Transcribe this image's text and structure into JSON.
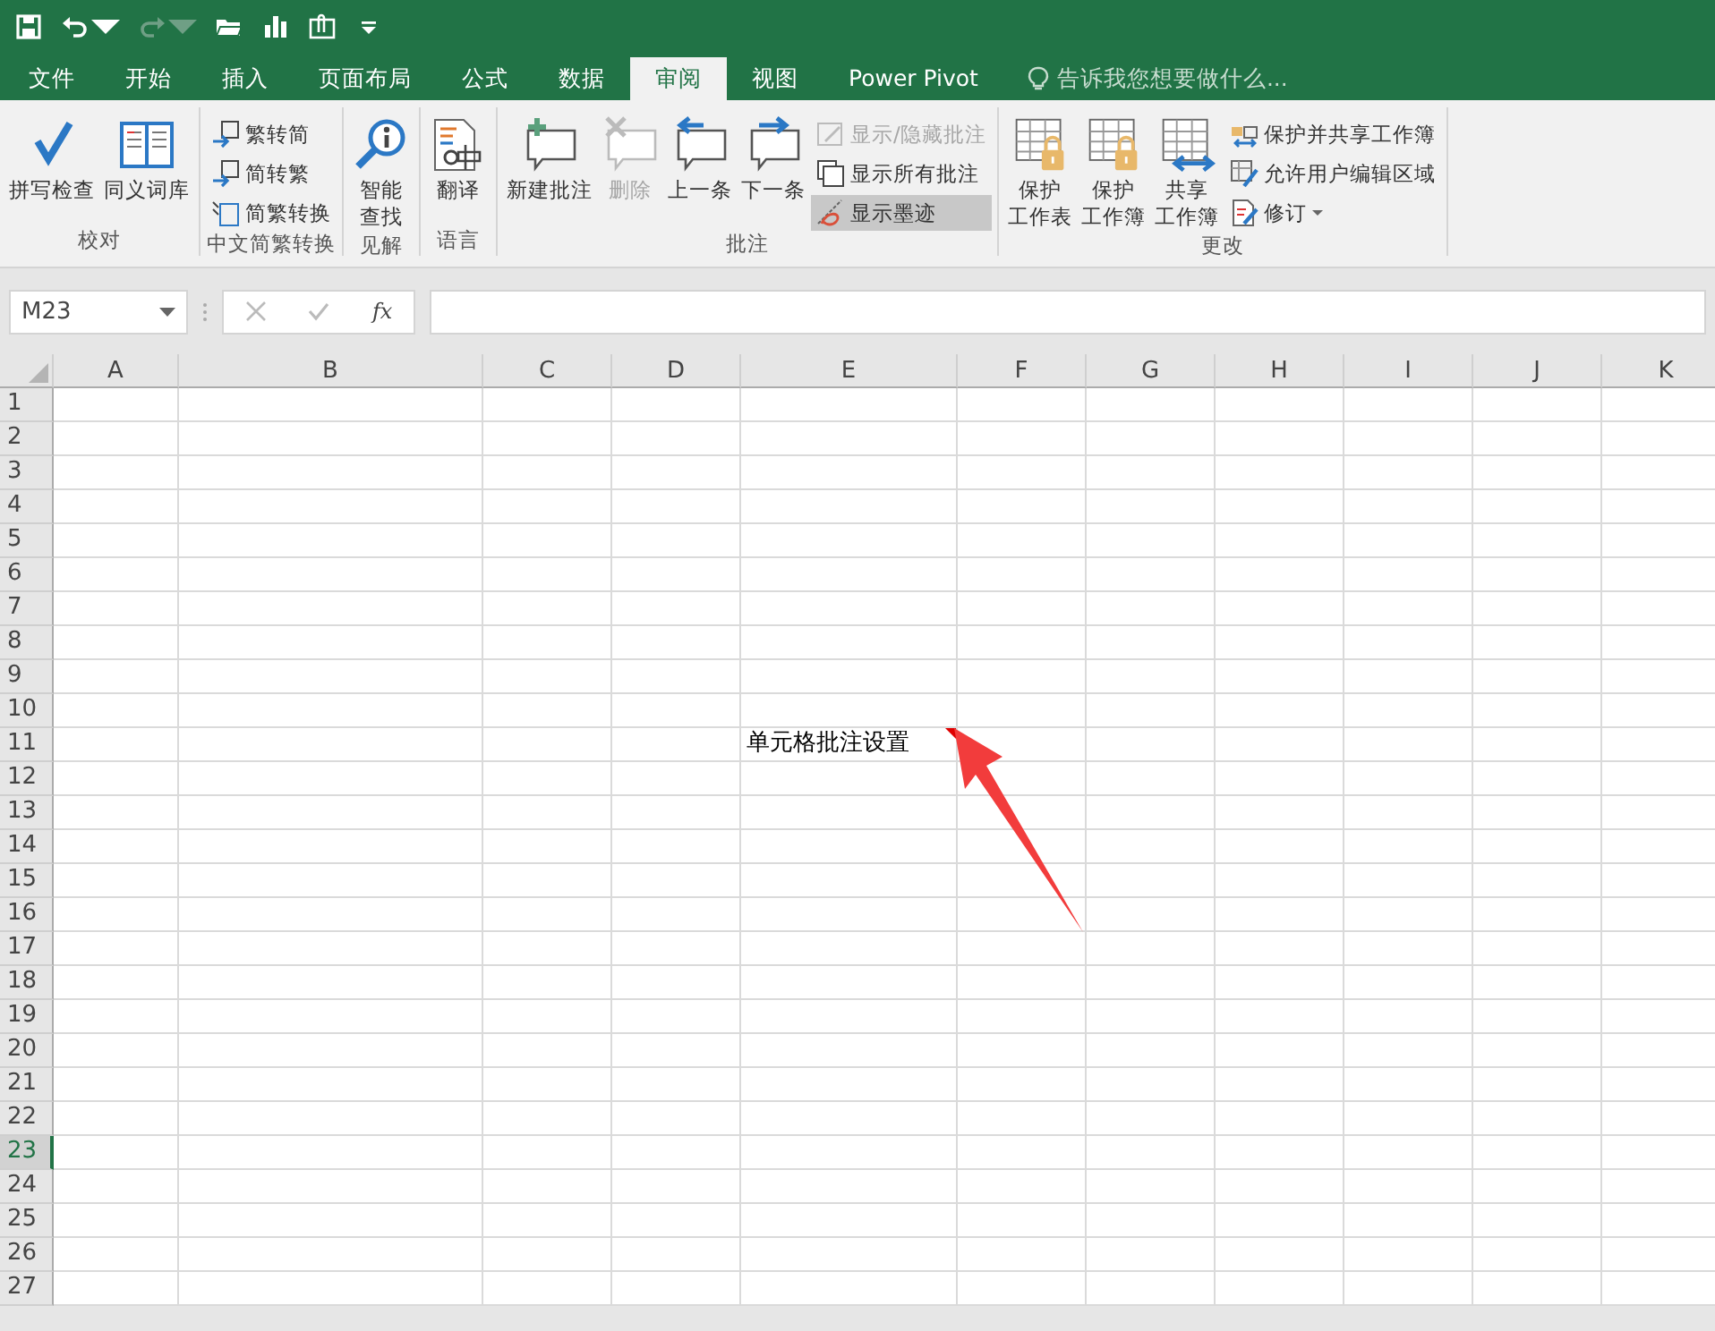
{
  "quick_access": [
    {
      "disabled": false,
      "dropdown": false
    },
    {
      "disabled": false,
      "dropdown": true
    },
    {
      "disabled": true,
      "dropdown": true
    },
    {
      "disabled": false,
      "dropdown": false
    },
    {
      "disabled": false,
      "dropdown": false
    },
    {
      "disabled": false,
      "dropdown": false
    },
    {
      "disabled": false,
      "dropdown": false
    }
  ],
  "tabs": [
    {
      "label": "文件",
      "selected": false
    },
    {
      "label": "开始",
      "selected": false
    },
    {
      "label": "插入",
      "selected": false
    },
    {
      "label": "页面布局",
      "selected": false
    },
    {
      "label": "公式",
      "selected": false
    },
    {
      "label": "数据",
      "selected": false
    },
    {
      "label": "审阅",
      "selected": true
    },
    {
      "label": "视图",
      "selected": false
    },
    {
      "label": "Power Pivot",
      "selected": false
    }
  ],
  "tell_me": {
    "placeholder": "告诉我您想要做什么..."
  },
  "ribbon": {
    "groups": [
      {
        "name": "校对",
        "items": [
          {
            "kind": "large",
            "label": [
              "拼写检查"
            ],
            "disabled": false,
            "selected": false,
            "dropdown": false
          },
          {
            "kind": "large",
            "label": [
              "同义词库"
            ],
            "disabled": false,
            "selected": false,
            "dropdown": false
          }
        ]
      },
      {
        "name": "中文简繁转换",
        "items": [
          {
            "kind": "small",
            "label": [
              "繁转简"
            ],
            "disabled": false,
            "selected": false,
            "dropdown": false
          },
          {
            "kind": "small",
            "label": [
              "简转繁"
            ],
            "disabled": false,
            "selected": false,
            "dropdown": false
          },
          {
            "kind": "small",
            "label": [
              "简繁转换"
            ],
            "disabled": false,
            "selected": false,
            "dropdown": false
          }
        ]
      },
      {
        "name": "见解",
        "items": [
          {
            "kind": "large",
            "label": [
              "智能",
              "查找"
            ],
            "disabled": false,
            "selected": false,
            "dropdown": false
          }
        ]
      },
      {
        "name": "语言",
        "items": [
          {
            "kind": "large",
            "label": [
              "翻译"
            ],
            "disabled": false,
            "selected": false,
            "dropdown": false
          }
        ]
      },
      {
        "name": "批注",
        "items": [
          {
            "kind": "large",
            "label": [
              "新建批注"
            ],
            "disabled": false,
            "selected": false,
            "dropdown": false
          },
          {
            "kind": "large",
            "label": [
              "删除"
            ],
            "disabled": true,
            "selected": false,
            "dropdown": false
          },
          {
            "kind": "large",
            "label": [
              "上一条"
            ],
            "disabled": false,
            "selected": false,
            "dropdown": false
          },
          {
            "kind": "large",
            "label": [
              "下一条"
            ],
            "disabled": false,
            "selected": false,
            "dropdown": false
          },
          {
            "kind": "small",
            "label": [
              "显示/隐藏批注"
            ],
            "disabled": true,
            "selected": false,
            "dropdown": false
          },
          {
            "kind": "small",
            "label": [
              "显示所有批注"
            ],
            "disabled": false,
            "selected": false,
            "dropdown": false
          },
          {
            "kind": "small",
            "label": [
              "显示墨迹"
            ],
            "disabled": false,
            "selected": true,
            "dropdown": false
          }
        ]
      },
      {
        "name": "更改",
        "items": [
          {
            "kind": "large",
            "label": [
              "保护",
              "工作表"
            ],
            "disabled": false,
            "selected": false,
            "dropdown": false
          },
          {
            "kind": "large",
            "label": [
              "保护",
              "工作簿"
            ],
            "disabled": false,
            "selected": false,
            "dropdown": false
          },
          {
            "kind": "large",
            "label": [
              "共享",
              "工作簿"
            ],
            "disabled": false,
            "selected": false,
            "dropdown": false
          },
          {
            "kind": "small",
            "label": [
              "保护并共享工作簿"
            ],
            "disabled": false,
            "selected": false,
            "dropdown": false
          },
          {
            "kind": "small",
            "label": [
              "允许用户编辑区域"
            ],
            "disabled": false,
            "selected": false,
            "dropdown": false
          },
          {
            "kind": "small",
            "label": [
              "修订"
            ],
            "disabled": false,
            "selected": false,
            "dropdown": true
          }
        ]
      }
    ]
  },
  "formula_bar": {
    "name_box": "M23",
    "function_label": "fx"
  },
  "sheet": {
    "columns": [
      "A",
      "B",
      "C",
      "D",
      "E",
      "F",
      "G",
      "H",
      "I",
      "J",
      "K"
    ],
    "rows": [
      {
        "label": "1",
        "selected": false
      },
      {
        "label": "2",
        "selected": false
      },
      {
        "label": "3",
        "selected": false
      },
      {
        "label": "4",
        "selected": false
      },
      {
        "label": "5",
        "selected": false
      },
      {
        "label": "6",
        "selected": false
      },
      {
        "label": "7",
        "selected": false
      },
      {
        "label": "8",
        "selected": false
      },
      {
        "label": "9",
        "selected": false
      },
      {
        "label": "10",
        "selected": false
      },
      {
        "label": "11",
        "selected": false,
        "cells": [
          {},
          {},
          {},
          {},
          {
            "text": "单元格批注设置",
            "comment": true
          }
        ]
      },
      {
        "label": "12",
        "selected": false
      },
      {
        "label": "13",
        "selected": false
      },
      {
        "label": "14",
        "selected": false
      },
      {
        "label": "15",
        "selected": false
      },
      {
        "label": "16",
        "selected": false
      },
      {
        "label": "17",
        "selected": false
      },
      {
        "label": "18",
        "selected": false
      },
      {
        "label": "19",
        "selected": false
      },
      {
        "label": "20",
        "selected": false
      },
      {
        "label": "21",
        "selected": false
      },
      {
        "label": "22",
        "selected": false
      },
      {
        "label": "23",
        "selected": true
      },
      {
        "label": "24",
        "selected": false
      },
      {
        "label": "25",
        "selected": false
      },
      {
        "label": "26",
        "selected": false
      },
      {
        "label": "27",
        "selected": false
      }
    ]
  }
}
